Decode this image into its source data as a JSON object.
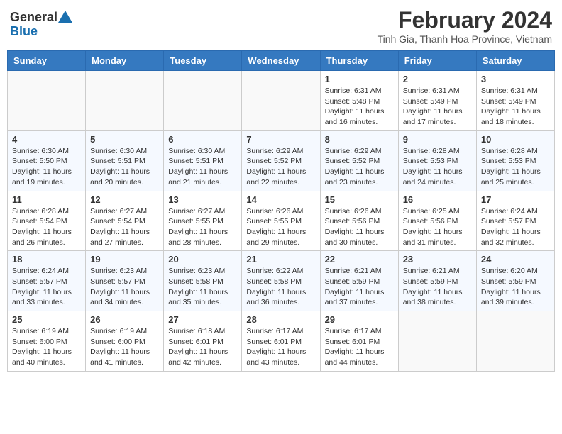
{
  "logo": {
    "general": "General",
    "blue": "Blue"
  },
  "title": "February 2024",
  "subtitle": "Tinh Gia, Thanh Hoa Province, Vietnam",
  "days": [
    "Sunday",
    "Monday",
    "Tuesday",
    "Wednesday",
    "Thursday",
    "Friday",
    "Saturday"
  ],
  "weeks": [
    [
      {
        "day": "",
        "info": ""
      },
      {
        "day": "",
        "info": ""
      },
      {
        "day": "",
        "info": ""
      },
      {
        "day": "",
        "info": ""
      },
      {
        "day": "1",
        "info": "Sunrise: 6:31 AM\nSunset: 5:48 PM\nDaylight: 11 hours and 16 minutes."
      },
      {
        "day": "2",
        "info": "Sunrise: 6:31 AM\nSunset: 5:49 PM\nDaylight: 11 hours and 17 minutes."
      },
      {
        "day": "3",
        "info": "Sunrise: 6:31 AM\nSunset: 5:49 PM\nDaylight: 11 hours and 18 minutes."
      }
    ],
    [
      {
        "day": "4",
        "info": "Sunrise: 6:30 AM\nSunset: 5:50 PM\nDaylight: 11 hours and 19 minutes."
      },
      {
        "day": "5",
        "info": "Sunrise: 6:30 AM\nSunset: 5:51 PM\nDaylight: 11 hours and 20 minutes."
      },
      {
        "day": "6",
        "info": "Sunrise: 6:30 AM\nSunset: 5:51 PM\nDaylight: 11 hours and 21 minutes."
      },
      {
        "day": "7",
        "info": "Sunrise: 6:29 AM\nSunset: 5:52 PM\nDaylight: 11 hours and 22 minutes."
      },
      {
        "day": "8",
        "info": "Sunrise: 6:29 AM\nSunset: 5:52 PM\nDaylight: 11 hours and 23 minutes."
      },
      {
        "day": "9",
        "info": "Sunrise: 6:28 AM\nSunset: 5:53 PM\nDaylight: 11 hours and 24 minutes."
      },
      {
        "day": "10",
        "info": "Sunrise: 6:28 AM\nSunset: 5:53 PM\nDaylight: 11 hours and 25 minutes."
      }
    ],
    [
      {
        "day": "11",
        "info": "Sunrise: 6:28 AM\nSunset: 5:54 PM\nDaylight: 11 hours and 26 minutes."
      },
      {
        "day": "12",
        "info": "Sunrise: 6:27 AM\nSunset: 5:54 PM\nDaylight: 11 hours and 27 minutes."
      },
      {
        "day": "13",
        "info": "Sunrise: 6:27 AM\nSunset: 5:55 PM\nDaylight: 11 hours and 28 minutes."
      },
      {
        "day": "14",
        "info": "Sunrise: 6:26 AM\nSunset: 5:55 PM\nDaylight: 11 hours and 29 minutes."
      },
      {
        "day": "15",
        "info": "Sunrise: 6:26 AM\nSunset: 5:56 PM\nDaylight: 11 hours and 30 minutes."
      },
      {
        "day": "16",
        "info": "Sunrise: 6:25 AM\nSunset: 5:56 PM\nDaylight: 11 hours and 31 minutes."
      },
      {
        "day": "17",
        "info": "Sunrise: 6:24 AM\nSunset: 5:57 PM\nDaylight: 11 hours and 32 minutes."
      }
    ],
    [
      {
        "day": "18",
        "info": "Sunrise: 6:24 AM\nSunset: 5:57 PM\nDaylight: 11 hours and 33 minutes."
      },
      {
        "day": "19",
        "info": "Sunrise: 6:23 AM\nSunset: 5:57 PM\nDaylight: 11 hours and 34 minutes."
      },
      {
        "day": "20",
        "info": "Sunrise: 6:23 AM\nSunset: 5:58 PM\nDaylight: 11 hours and 35 minutes."
      },
      {
        "day": "21",
        "info": "Sunrise: 6:22 AM\nSunset: 5:58 PM\nDaylight: 11 hours and 36 minutes."
      },
      {
        "day": "22",
        "info": "Sunrise: 6:21 AM\nSunset: 5:59 PM\nDaylight: 11 hours and 37 minutes."
      },
      {
        "day": "23",
        "info": "Sunrise: 6:21 AM\nSunset: 5:59 PM\nDaylight: 11 hours and 38 minutes."
      },
      {
        "day": "24",
        "info": "Sunrise: 6:20 AM\nSunset: 5:59 PM\nDaylight: 11 hours and 39 minutes."
      }
    ],
    [
      {
        "day": "25",
        "info": "Sunrise: 6:19 AM\nSunset: 6:00 PM\nDaylight: 11 hours and 40 minutes."
      },
      {
        "day": "26",
        "info": "Sunrise: 6:19 AM\nSunset: 6:00 PM\nDaylight: 11 hours and 41 minutes."
      },
      {
        "day": "27",
        "info": "Sunrise: 6:18 AM\nSunset: 6:01 PM\nDaylight: 11 hours and 42 minutes."
      },
      {
        "day": "28",
        "info": "Sunrise: 6:17 AM\nSunset: 6:01 PM\nDaylight: 11 hours and 43 minutes."
      },
      {
        "day": "29",
        "info": "Sunrise: 6:17 AM\nSunset: 6:01 PM\nDaylight: 11 hours and 44 minutes."
      },
      {
        "day": "",
        "info": ""
      },
      {
        "day": "",
        "info": ""
      }
    ]
  ]
}
